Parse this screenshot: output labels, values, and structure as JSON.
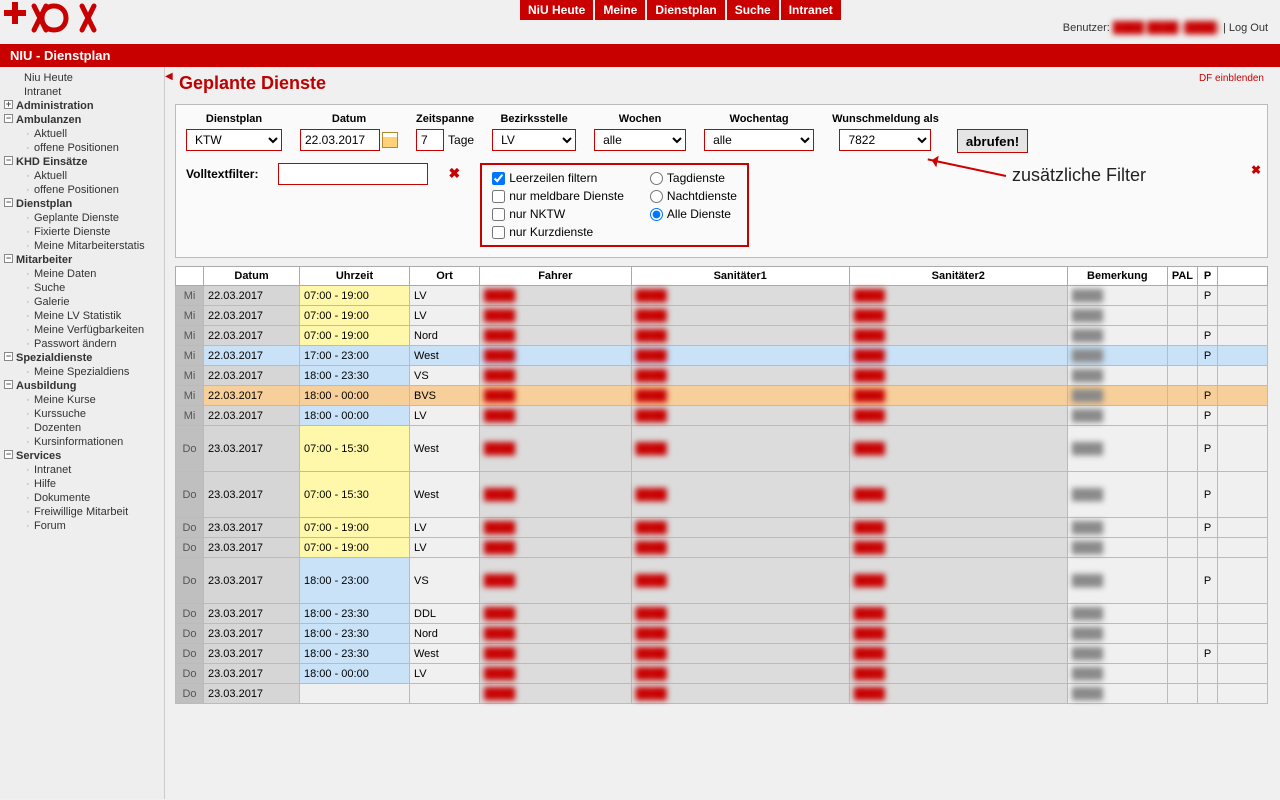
{
  "topnav": [
    "NiU Heute",
    "Meine",
    "Dienstplan",
    "Suche",
    "Intranet"
  ],
  "user_label": "Benutzer:",
  "user_name": "████ ████ (████)",
  "logout": "Log Out",
  "section_title": "NIU - Dienstplan",
  "df_link": "DF einblenden",
  "page_title": "Geplante Dienste",
  "sidebar": [
    {
      "t": "Niu Heute",
      "k": "sub",
      "ind": 24
    },
    {
      "t": "Intranet",
      "k": "sub",
      "ind": 24
    },
    {
      "t": "Administration",
      "k": "sec",
      "tog": "+"
    },
    {
      "t": "Ambulanzen",
      "k": "sec",
      "tog": "−"
    },
    {
      "t": "Aktuell",
      "k": "sub"
    },
    {
      "t": "offene Positionen",
      "k": "sub"
    },
    {
      "t": "KHD Einsätze",
      "k": "sec",
      "tog": "−"
    },
    {
      "t": "Aktuell",
      "k": "sub"
    },
    {
      "t": "offene Positionen",
      "k": "sub"
    },
    {
      "t": "Dienstplan",
      "k": "sec",
      "tog": "−"
    },
    {
      "t": "Geplante Dienste",
      "k": "sub"
    },
    {
      "t": "Fixierte Dienste",
      "k": "sub"
    },
    {
      "t": "Meine Mitarbeiterstatis",
      "k": "sub"
    },
    {
      "t": "Mitarbeiter",
      "k": "sec",
      "tog": "−"
    },
    {
      "t": "Meine Daten",
      "k": "sub"
    },
    {
      "t": "Suche",
      "k": "sub"
    },
    {
      "t": "Galerie",
      "k": "sub"
    },
    {
      "t": "Meine LV Statistik",
      "k": "sub"
    },
    {
      "t": "Meine Verfügbarkeiten",
      "k": "sub"
    },
    {
      "t": "Passwort ändern",
      "k": "sub"
    },
    {
      "t": "Spezialdienste",
      "k": "sec",
      "tog": "−"
    },
    {
      "t": "Meine Spezialdiens",
      "k": "sub"
    },
    {
      "t": "Ausbildung",
      "k": "sec",
      "tog": "−"
    },
    {
      "t": "Meine Kurse",
      "k": "sub"
    },
    {
      "t": "Kurssuche",
      "k": "sub"
    },
    {
      "t": "Dozenten",
      "k": "sub"
    },
    {
      "t": "Kursinformationen",
      "k": "sub"
    },
    {
      "t": "Services",
      "k": "sec",
      "tog": "−"
    },
    {
      "t": "Intranet",
      "k": "sub"
    },
    {
      "t": "Hilfe",
      "k": "sub"
    },
    {
      "t": "Dokumente",
      "k": "sub"
    },
    {
      "t": "Freiwillige Mitarbeit",
      "k": "sub"
    },
    {
      "t": "Forum",
      "k": "sub"
    }
  ],
  "filters": {
    "dienstplan_label": "Dienstplan",
    "dienstplan_value": "KTW",
    "datum_label": "Datum",
    "datum_value": "22.03.2017",
    "zeitspanne_label": "Zeitspanne",
    "zeitspanne_value": "7",
    "zeitspanne_unit": "Tage",
    "bezirksstelle_label": "Bezirksstelle",
    "bezirksstelle_value": "LV",
    "wochen_label": "Wochen",
    "wochen_value": "alle",
    "wochentag_label": "Wochentag",
    "wochentag_value": "alle",
    "wunsch_label": "Wunschmeldung als",
    "wunsch_value": "7822",
    "abrufen": "abrufen!",
    "volltext_label": "Volltextfilter:",
    "cb_leerzeilen": "Leerzeilen filtern",
    "cb_meldbare": "nur meldbare Dienste",
    "cb_nktw": "nur NKTW",
    "cb_kurz": "nur Kurzdienste",
    "rb_tag": "Tagdienste",
    "rb_nacht": "Nachtdienste",
    "rb_alle": "Alle Dienste",
    "annotation": "zusätzliche Filter"
  },
  "table": {
    "headers": [
      "",
      "Datum",
      "Uhrzeit",
      "Ort",
      "Fahrer",
      "Sanitäter1",
      "Sanitäter2",
      "Bemerkung",
      "PAL",
      "P",
      ""
    ],
    "rows": [
      {
        "day": "Mi",
        "date": "22.03.2017",
        "time": "07:00 - 19:00",
        "tclass": "t-yellow",
        "ort": "LV",
        "p": "P"
      },
      {
        "day": "Mi",
        "date": "22.03.2017",
        "time": "07:00 - 19:00",
        "tclass": "t-yellow",
        "ort": "LV",
        "p": ""
      },
      {
        "day": "Mi",
        "date": "22.03.2017",
        "time": "07:00 - 19:00",
        "tclass": "t-yellow",
        "ort": "Nord",
        "p": "P"
      },
      {
        "day": "Mi",
        "date": "22.03.2017",
        "time": "17:00 - 23:00",
        "tclass": "t-blue",
        "ort": "West",
        "rowcls": "row-blue",
        "p": "P"
      },
      {
        "day": "Mi",
        "date": "22.03.2017",
        "time": "18:00 - 23:30",
        "tclass": "t-blue",
        "ort": "VS",
        "p": ""
      },
      {
        "day": "Mi",
        "date": "22.03.2017",
        "time": "18:00 - 00:00",
        "tclass": "t-blue",
        "ort": "BVS",
        "rowcls": "row-orange",
        "p": "P"
      },
      {
        "day": "Mi",
        "date": "22.03.2017",
        "time": "18:00 - 00:00",
        "tclass": "t-blue",
        "ort": "LV",
        "p": "P"
      },
      {
        "day": "Do",
        "date": "23.03.2017",
        "time": "07:00 - 15:30",
        "tclass": "t-yellow",
        "ort": "West",
        "tall": true,
        "p": "P"
      },
      {
        "day": "Do",
        "date": "23.03.2017",
        "time": "07:00 - 15:30",
        "tclass": "t-yellow",
        "ort": "West",
        "tall": true,
        "p": "P"
      },
      {
        "day": "Do",
        "date": "23.03.2017",
        "time": "07:00 - 19:00",
        "tclass": "t-yellow",
        "ort": "LV",
        "p": "P"
      },
      {
        "day": "Do",
        "date": "23.03.2017",
        "time": "07:00 - 19:00",
        "tclass": "t-yellow",
        "ort": "LV",
        "p": ""
      },
      {
        "day": "Do",
        "date": "23.03.2017",
        "time": "18:00 - 23:00",
        "tclass": "t-blue",
        "ort": "VS",
        "tall": true,
        "p": "P"
      },
      {
        "day": "Do",
        "date": "23.03.2017",
        "time": "18:00 - 23:30",
        "tclass": "t-blue",
        "ort": "DDL",
        "p": ""
      },
      {
        "day": "Do",
        "date": "23.03.2017",
        "time": "18:00 - 23:30",
        "tclass": "t-blue",
        "ort": "Nord",
        "p": ""
      },
      {
        "day": "Do",
        "date": "23.03.2017",
        "time": "18:00 - 23:30",
        "tclass": "t-blue",
        "ort": "West",
        "p": "P"
      },
      {
        "day": "Do",
        "date": "23.03.2017",
        "time": "18:00 - 00:00",
        "tclass": "t-blue",
        "ort": "LV",
        "p": ""
      },
      {
        "day": "Do",
        "date": "23.03.2017",
        "time": "",
        "tclass": "",
        "ort": "",
        "p": ""
      }
    ]
  }
}
